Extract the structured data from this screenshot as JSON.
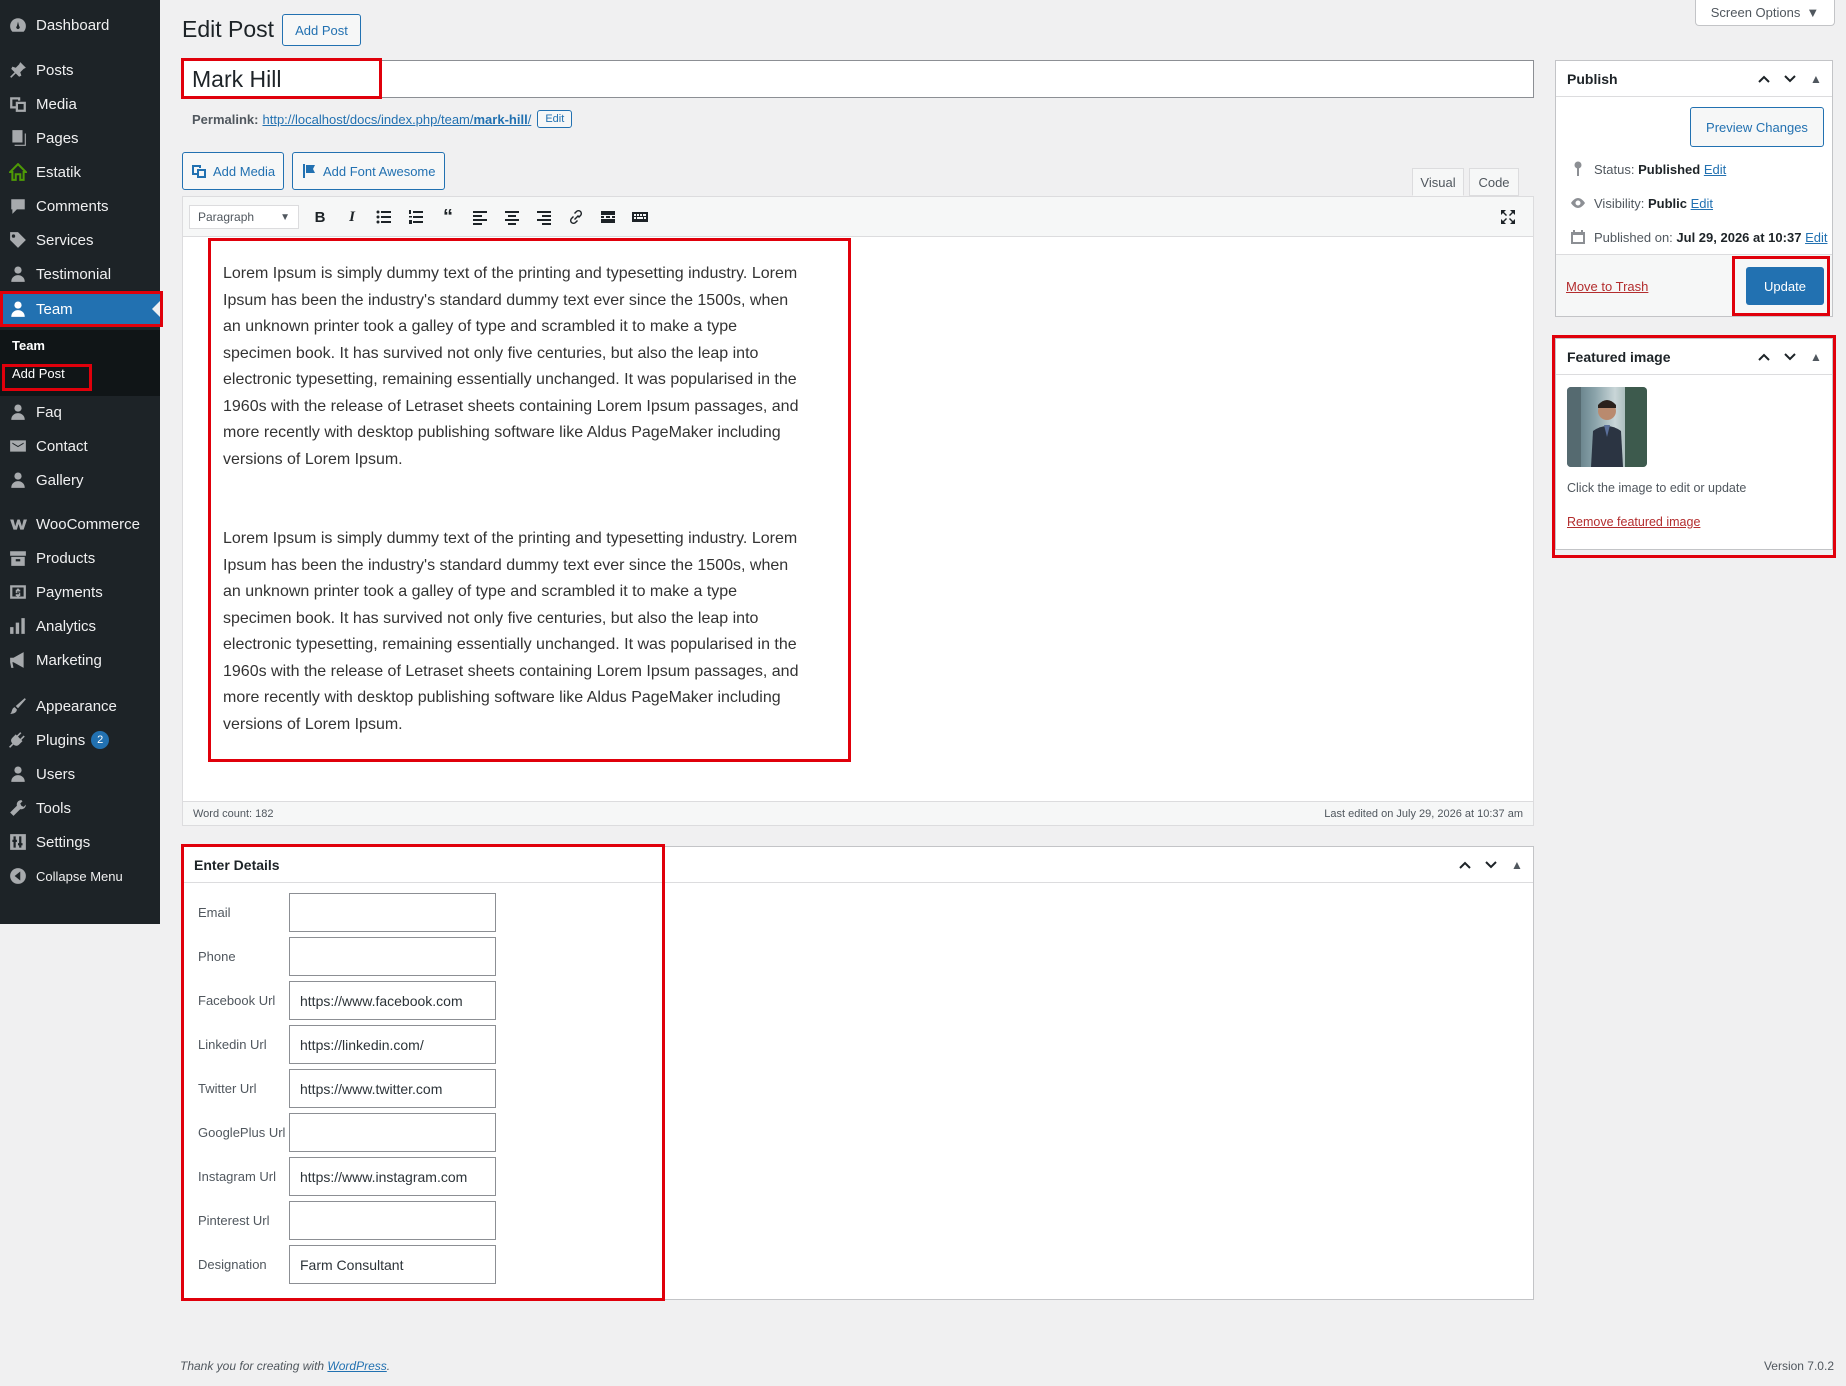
{
  "sidebar": {
    "items": [
      {
        "label": "Dashboard",
        "icon": "dashboard-icon"
      },
      {
        "label": "Posts",
        "icon": "pin-icon"
      },
      {
        "label": "Media",
        "icon": "media-icon"
      },
      {
        "label": "Pages",
        "icon": "pages-icon"
      },
      {
        "label": "Estatik",
        "icon": "house-icon"
      },
      {
        "label": "Comments",
        "icon": "comment-icon"
      },
      {
        "label": "Services",
        "icon": "tag-icon"
      },
      {
        "label": "Testimonial",
        "icon": "user-icon"
      },
      {
        "label": "Team",
        "icon": "user-icon"
      },
      {
        "label": "Faq",
        "icon": "user-icon"
      },
      {
        "label": "Contact",
        "icon": "email-icon"
      },
      {
        "label": "Gallery",
        "icon": "user-icon"
      },
      {
        "label": "WooCommerce",
        "icon": "woocommerce-icon"
      },
      {
        "label": "Products",
        "icon": "archive-icon"
      },
      {
        "label": "Payments",
        "icon": "dollar-icon"
      },
      {
        "label": "Analytics",
        "icon": "chart-icon"
      },
      {
        "label": "Marketing",
        "icon": "megaphone-icon"
      },
      {
        "label": "Appearance",
        "icon": "brush-icon"
      },
      {
        "label": "Plugins",
        "icon": "plugin-icon",
        "badge": "2"
      },
      {
        "label": "Users",
        "icon": "users-icon"
      },
      {
        "label": "Tools",
        "icon": "wrench-icon"
      },
      {
        "label": "Settings",
        "icon": "settings-icon"
      },
      {
        "label": "Collapse Menu",
        "icon": "collapse-icon"
      }
    ],
    "submenu": {
      "heading": "Team",
      "add_post": "Add Post"
    }
  },
  "header": {
    "title": "Edit Post",
    "add_post_button": "Add Post",
    "screen_options": "Screen Options"
  },
  "post": {
    "title": "Mark Hill",
    "permalink_label": "Permalink:",
    "permalink_base": "http://localhost/docs/index.php/team/",
    "permalink_slug": "mark-hill",
    "permalink_trailing": "/",
    "permalink_edit": "Edit"
  },
  "editor": {
    "add_media": "Add Media",
    "add_font_awesome": "Add Font Awesome",
    "tab_visual": "Visual",
    "tab_code": "Code",
    "format": "Paragraph",
    "paragraphs": [
      "Lorem Ipsum is simply dummy text of the printing and typesetting industry. Lorem Ipsum has been the industry's standard dummy text ever since the 1500s, when an unknown printer took a galley of type and scrambled it to make a type specimen book. It has survived not only five centuries, but also the leap into electronic typesetting, remaining essentially unchanged. It was popularised in the 1960s with the release of Letraset sheets containing Lorem Ipsum passages, and more recently with desktop publishing software like Aldus PageMaker including versions of Lorem Ipsum.",
      "Lorem Ipsum is simply dummy text of the printing and typesetting industry. Lorem Ipsum has been the industry's standard dummy text ever since the 1500s, when an unknown printer took a galley of type and scrambled it to make a type specimen book. It has survived not only five centuries, but also the leap into electronic typesetting, remaining essentially unchanged. It was popularised in the 1960s with the release of Letraset sheets containing Lorem Ipsum passages, and more recently with desktop publishing software like Aldus PageMaker including versions of Lorem Ipsum."
    ],
    "word_count": "Word count: 182",
    "last_edited": "Last edited on July 29, 2026 at 10:37 am"
  },
  "publish": {
    "title": "Publish",
    "preview": "Preview Changes",
    "status_label": "Status:",
    "status_value": "Published",
    "visibility_label": "Visibility:",
    "visibility_value": "Public",
    "published_label": "Published on:",
    "published_value": "Jul 29, 2026 at 10:37",
    "edit": "Edit",
    "trash": "Move to Trash",
    "update": "Update"
  },
  "featured": {
    "title": "Featured image",
    "hint": "Click the image to edit or update",
    "remove": "Remove featured image"
  },
  "details": {
    "title": "Enter Details",
    "fields": [
      {
        "label": "Email",
        "value": ""
      },
      {
        "label": "Phone",
        "value": ""
      },
      {
        "label": "Facebook Url",
        "value": "https://www.facebook.com"
      },
      {
        "label": "Linkedin Url",
        "value": "https://linkedin.com/"
      },
      {
        "label": "Twitter Url",
        "value": "https://www.twitter.com"
      },
      {
        "label": "GooglePlus Url",
        "value": ""
      },
      {
        "label": "Instagram Url",
        "value": "https://www.instagram.com"
      },
      {
        "label": "Pinterest Url",
        "value": ""
      },
      {
        "label": "Designation",
        "value": "Farm Consultant"
      }
    ]
  },
  "footer": {
    "thanks_prefix": "Thank you for creating with",
    "wordpress": "WordPress",
    "thanks_suffix": ".",
    "version": "Version 7.0.2"
  },
  "colors": {
    "sidebar_bg": "#1d2327",
    "accent": "#2271b1",
    "annotation": "#e0000b"
  }
}
